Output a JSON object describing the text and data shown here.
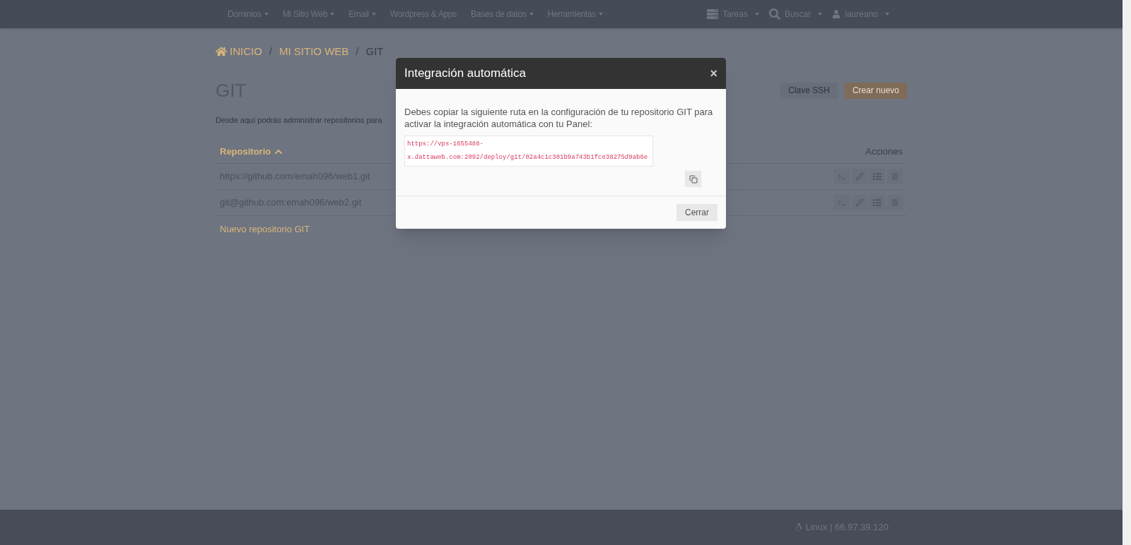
{
  "navbar": {
    "menus": [
      {
        "label": "Dominios",
        "dropdown": true
      },
      {
        "label": "Mi Sitio Web",
        "dropdown": true
      },
      {
        "label": "Email",
        "dropdown": true
      },
      {
        "label": "Wordpress & Apps",
        "dropdown": false
      },
      {
        "label": "Bases de datos",
        "dropdown": true
      },
      {
        "label": "Herramientas",
        "dropdown": true
      }
    ],
    "right": [
      {
        "kind": "tasks",
        "label": "Tareas"
      },
      {
        "kind": "search",
        "label": "Buscar"
      },
      {
        "kind": "user",
        "label": "laureano"
      }
    ]
  },
  "breadcrumb": {
    "separator": "/",
    "items": [
      {
        "label": "INICIO",
        "link": true
      },
      {
        "label": "MI SITIO WEB",
        "link": true
      },
      {
        "label": "GIT",
        "link": false
      }
    ]
  },
  "page": {
    "title": "GIT",
    "description": "Desde aquí podrás administrar repositorios para",
    "buttons": [
      {
        "label": "Clave SSH",
        "primary": false
      },
      {
        "label": "Crear nuevo",
        "primary": true
      }
    ]
  },
  "table": {
    "columns": [
      {
        "label": "Repositorio",
        "sorted": true
      },
      {
        "label": "Acciones",
        "sorted": false
      }
    ],
    "rows": [
      {
        "repository": "https://github.com/emah096/web1.git"
      },
      {
        "repository": "git@github.com:emah096/web2.git"
      }
    ],
    "new_link": "Nuevo repositorio GIT"
  },
  "modal": {
    "title": "Integración automática",
    "close": "×",
    "message": "Debes copiar la siguiente ruta en la configuración de tu repositorio GIT para activar la integración automática con tu Panel:",
    "url": "https://vps-1655488-x.dattaweb.com:2092/deploy/git/02a4c1c301b9a743b1fce38275d9ab6e",
    "close_button": "Cerrar"
  },
  "footer": {
    "info": "Linux | 66.97.39.120"
  }
}
